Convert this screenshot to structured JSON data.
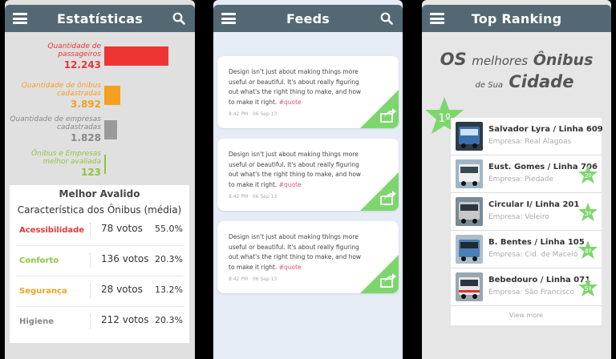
{
  "colors": {
    "header": "#536873",
    "passengers": "#ef3434",
    "buses": "#f5a020",
    "companies": "#9a9a9a",
    "rated": "#8dc63f",
    "accent_green": "#7dd66d"
  },
  "stats_screen": {
    "title": "Estatísticas",
    "stats": [
      {
        "label": "Quantidade de passageiros",
        "value": "12.243",
        "bar_fraction": 0.98
      },
      {
        "label": "Quantidade de ônibus cadastradas",
        "value": "3.892",
        "bar_fraction": 0.24
      },
      {
        "label": "Quantidade de empresas cadastradas",
        "value": "1.828",
        "bar_fraction": 0.2
      },
      {
        "label": "Ônibus e Empresas melhor avaliada",
        "value": "123",
        "bar_fraction": 0.03
      }
    ],
    "card": {
      "title": "Melhor Avalido",
      "subtitle": "Característica dos Ônibus (média)",
      "rows": [
        {
          "label": "Acessibilidade",
          "votes": "78 votos",
          "pct": "55.0%",
          "color": "#e53935"
        },
        {
          "label": "Conforto",
          "votes": "136 votos",
          "pct": "20.3%",
          "color": "#8dc63f"
        },
        {
          "label": "Segurança",
          "votes": "28 votos",
          "pct": "13.2%",
          "color": "#f5a020"
        },
        {
          "label": "Higiene",
          "votes": "212 votos",
          "pct": "20.3%",
          "color": "#888888"
        }
      ]
    }
  },
  "feeds_screen": {
    "title": "Feeds",
    "posts": [
      {
        "text": "Design isn't just about making things more useful or beautiful. It's about really figuring out what's the right thing to make, and how to make it right.",
        "tag": "#quote",
        "time": "8:42 PM",
        "date": "06 Sep 13"
      },
      {
        "text": "Design isn't just about making things more useful or beautiful. It's about really figuring out what's the right thing to make, and how to make it right.",
        "tag": "#quote",
        "time": "8:42 PM",
        "date": "06 Sep 13"
      },
      {
        "text": "Design isn't just about making things more useful or beautiful. It's about really figuring out what's the right thing to make, and how to make it right.",
        "tag": "#quote",
        "time": "8:42 PM",
        "date": "06 Sep 13"
      }
    ]
  },
  "ranking_screen": {
    "title": "Top Ranking",
    "heading": {
      "os": "OS",
      "melhores": "melhores",
      "onibus": "Ônibus",
      "de_sua": "de Sua",
      "cidade": "Cidade"
    },
    "first_badge": "1º",
    "items": [
      {
        "name": "Salvador Lyra / Linha 609",
        "company": "Empresa: Real Alagoas",
        "rank": "",
        "bus_color": "#3a6fa8"
      },
      {
        "name": "Eust. Gomes / Linha 706",
        "company": "Empresa: Piedade",
        "rank": "2º",
        "bus_color": "#f0f0f0"
      },
      {
        "name": "Circular I/ Linha 201",
        "company": "Empresa: Veleiro",
        "rank": "3º",
        "bus_color": "#c8c8c8"
      },
      {
        "name": "B. Bentes / Linha 105",
        "company": "Empresa: Cid. de Maceió",
        "rank": "4º",
        "bus_color": "#4c7fb5"
      },
      {
        "name": "Bebedouro / Linha 071",
        "company": "Empresa: São Francisco",
        "rank": "5º",
        "bus_color": "#e6e6e6"
      }
    ],
    "view_more": "View more"
  }
}
